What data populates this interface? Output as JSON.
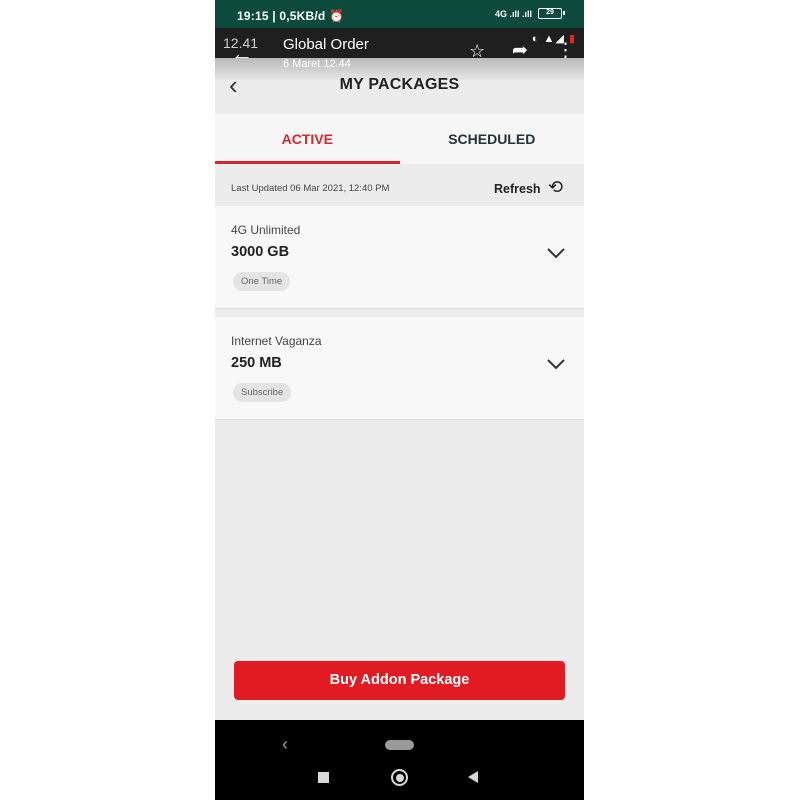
{
  "status_bar": {
    "time": "19:15 | 0,5KB/d",
    "signal": "4G .ıll .ıll",
    "battery": "29"
  },
  "notification": {
    "bg_time": "12.41",
    "title": "Global Order",
    "subtitle": "6 Maret 12.44"
  },
  "header": {
    "title": "MY PACKAGES"
  },
  "tabs": [
    {
      "label": "ACTIVE",
      "active": true
    },
    {
      "label": "SCHEDULED",
      "active": false
    }
  ],
  "update": {
    "last_updated": "Last Updated 06 Mar 2021, 12:40 PM",
    "refresh_label": "Refresh"
  },
  "packages": [
    {
      "name": "4G Unlimited",
      "size": "3000 GB",
      "badge": "One Time"
    },
    {
      "name": "Internet Vaganza",
      "size": "250 MB",
      "badge": "Subscribe"
    }
  ],
  "buy_button": {
    "label": "Buy Addon Package"
  },
  "colors": {
    "accent": "#d7262d",
    "button": "#e21b23",
    "status_bar": "#0c4a3c"
  },
  "icons": [
    "alarm-icon",
    "back-arrow-icon",
    "star-icon",
    "share-icon",
    "more-icon",
    "refresh-icon",
    "chevron-down-icon"
  ]
}
